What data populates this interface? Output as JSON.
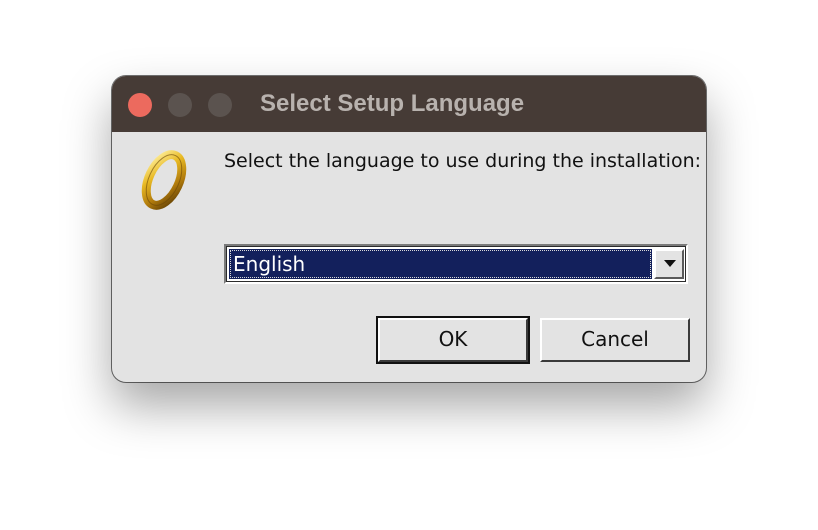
{
  "window": {
    "title": "Select Setup Language",
    "controls": [
      "close-icon",
      "minimize-icon",
      "maximize-icon"
    ],
    "colors": {
      "titlebar": "#463b36",
      "close": "#ec6a5e",
      "selection": "#13205c",
      "body": "#e3e3e3"
    }
  },
  "dialog": {
    "icon": "gold-ring-icon",
    "prompt": "Select the language to use during the installation:",
    "language_select": {
      "value": "English",
      "arrow_icon": "chevron-down-icon"
    },
    "buttons": {
      "ok": "OK",
      "cancel": "Cancel"
    }
  }
}
